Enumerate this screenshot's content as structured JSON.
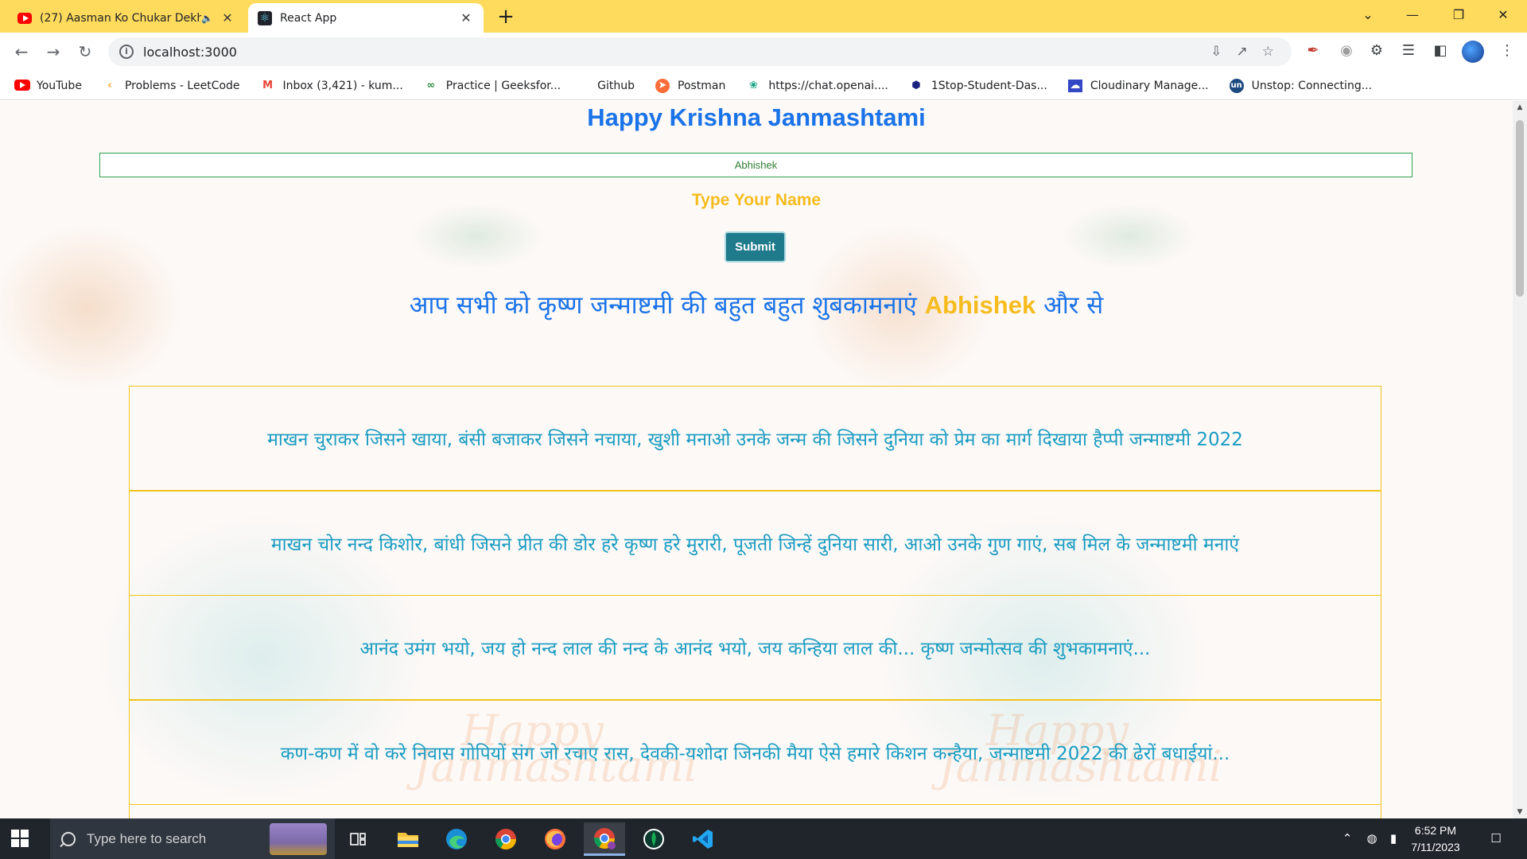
{
  "browser": {
    "tabs": [
      {
        "title": "(27) Aasman Ko Chukar Dekh",
        "icon": "youtube-icon",
        "audio": true
      },
      {
        "title": "React App",
        "icon": "react-icon",
        "audio": false
      }
    ],
    "url": "localhost:3000",
    "bookmarks": [
      {
        "label": "YouTube",
        "icon": "youtube-icon",
        "color": "#ff0000"
      },
      {
        "label": "Problems - LeetCode",
        "icon": "leetcode-icon",
        "color": "#f89f1b"
      },
      {
        "label": "Inbox (3,421) - kum...",
        "icon": "gmail-icon",
        "color": "#ea4335"
      },
      {
        "label": "Practice | Geeksfor...",
        "icon": "geeksforgeeks-icon",
        "color": "#2f8d46"
      },
      {
        "label": "Github",
        "icon": "github-icon",
        "color": "#202124"
      },
      {
        "label": "Postman",
        "icon": "postman-icon",
        "color": "#ff6c37"
      },
      {
        "label": "https://chat.openai....",
        "icon": "openai-icon",
        "color": "#10a37f"
      },
      {
        "label": "1Stop-Student-Das...",
        "icon": "onestop-icon",
        "color": "#1a237e"
      },
      {
        "label": "Cloudinary Manage...",
        "icon": "cloudinary-icon",
        "color": "#3448c5"
      },
      {
        "label": "Unstop: Connecting...",
        "icon": "unstop-icon",
        "color": "#1c4980"
      }
    ]
  },
  "page": {
    "title": "Happy Krishna Janmashtami",
    "name_input_value": "Abhishek",
    "input_label": "Type Your Name",
    "submit_label": "Submit",
    "greeting_prefix": "आप सभी को कृष्ण जन्माष्टमी की बहुत बहुत शुबकामनाएं",
    "greeting_name": "Abhishek",
    "greeting_suffix": "और से",
    "decor_text": [
      "Happy",
      "Janmashtami",
      "Happy",
      "Janmashtami"
    ],
    "wishes": [
      "माखन चुराकर जिसने खाया, बंसी बजाकर जिसने नचाया, खुशी मनाओ उनके जन्म की जिसने दुनिया को प्रेम का मार्ग दिखाया हैप्पी जन्माष्टमी 2022",
      "माखन चोर नन्द किशोर, बांधी जिसने प्रीत की डोर हरे कृष्ण हरे मुरारी, पूजती जिन्हें दुनिया सारी, आओ उनके गुण गाएं, सब मिल के जन्माष्टमी मनाएं",
      "आनंद उमंग भयो, जय हो नन्द लाल की नन्द के आनंद भयो, जय कन्हिया लाल की... कृष्ण जन्मोत्सव की शुभकामनाएं...",
      "कण-कण में वो करे निवास गोपियों संग जो रचाए रास, देवकी-यशोदा जिनकी मैया ऐसे हमारे किशन कन्हैया, जन्माष्टमी 2022 की ढेरों बधाईयां..."
    ],
    "colors": {
      "title": "#1a73e8",
      "accent": "#f6bc1e",
      "wish_text": "#1a9cc2",
      "button": "#1f7a8c"
    }
  },
  "taskbar": {
    "search_placeholder": "Type here to search",
    "apps": [
      "task-view-icon",
      "file-explorer-icon",
      "edge-icon",
      "chrome-icon",
      "firefox-icon",
      "chrome-profile-icon",
      "mongodb-compass-icon",
      "vscode-icon"
    ],
    "time": "6:52 PM",
    "date": "7/11/2023"
  }
}
